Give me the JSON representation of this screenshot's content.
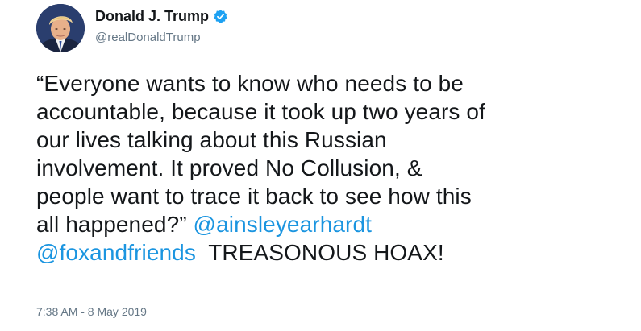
{
  "author": {
    "display_name": "Donald J. Trump",
    "handle": "@realDonaldTrump",
    "verified": true,
    "verified_color": "#1da1f2",
    "avatar_icon": "profile-photo"
  },
  "tweet": {
    "lines": [
      "“Everyone wants to know who needs to be",
      "accountable, because it took up two years of",
      "our lives talking about this Russian",
      "involvement. It proved No Collusion, &",
      "people want to trace it back to see how this"
    ],
    "line6_text": "all happened?” ",
    "mention_1": "@ainsleyearhardt",
    "mention_2": "@foxandfriends",
    "closing_text": "TREASONOUS HOAX!",
    "mention_color": "#1b95e0"
  },
  "meta": {
    "timestamp": "7:38 AM - 8 May 2019"
  }
}
